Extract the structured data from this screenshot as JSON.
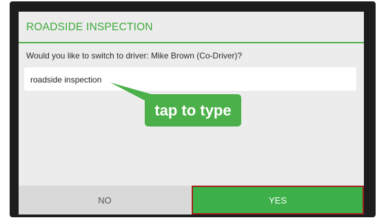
{
  "dialog": {
    "title": "ROADSIDE INSPECTION",
    "prompt": "Would you like to switch to driver: Mike Brown (Co-Driver)?",
    "input_value": "roadside inspection",
    "tooltip": "tap to type",
    "buttons": {
      "no": "NO",
      "yes": "YES"
    }
  },
  "colors": {
    "accent_green": "#3daa3c",
    "yes_button": "#3db04a",
    "highlight_border": "#a51d1d"
  }
}
